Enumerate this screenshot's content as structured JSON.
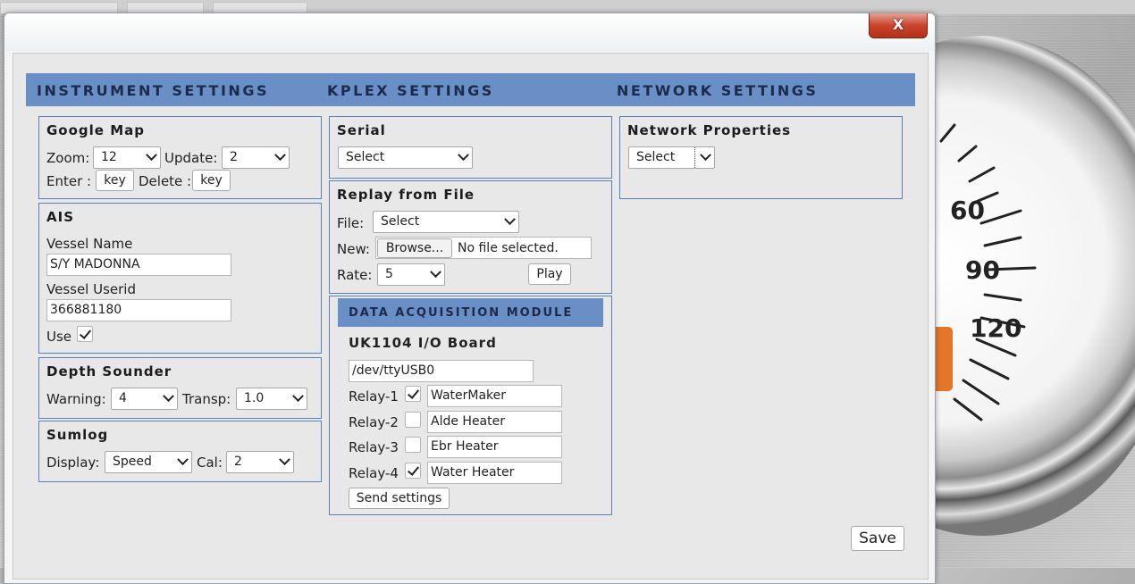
{
  "window": {
    "close_label": "X"
  },
  "headers": {
    "instrument": "INSTRUMENT SETTINGS",
    "kplex": "KPLEX SETTINGS",
    "network": "NETWORK SETTINGS"
  },
  "google_map": {
    "title": "Google Map",
    "zoom_label": "Zoom:",
    "zoom_value": "12",
    "update_label": "Update:",
    "update_value": "2",
    "enter_label": "Enter :",
    "enter_value": "key",
    "delete_label": "Delete :",
    "delete_value": "key"
  },
  "ais": {
    "title": "AIS",
    "vessel_name_label": "Vessel Name",
    "vessel_name_value": "S/Y MADONNA",
    "vessel_userid_label": "Vessel Userid",
    "vessel_userid_value": "366881180",
    "use_label": "Use",
    "use_checked": true
  },
  "depth": {
    "title": "Depth Sounder",
    "warning_label": "Warning:",
    "warning_value": "4",
    "transp_label": "Transp:",
    "transp_value": "1.0"
  },
  "sumlog": {
    "title": "Sumlog",
    "display_label": "Display:",
    "display_value": "Speed",
    "cal_label": "Cal:",
    "cal_value": "2"
  },
  "serial": {
    "title": "Serial",
    "select_value": "Select"
  },
  "replay": {
    "title": "Replay from File",
    "file_label": "File:",
    "file_value": "Select",
    "new_label": "New:",
    "browse_label": "Browse...",
    "no_file": "No file selected.",
    "rate_label": "Rate:",
    "rate_value": "5",
    "play_label": "Play"
  },
  "dam": {
    "title": "DATA ACQUISITION MODULE",
    "board_title": "UK1104 I/O Board",
    "device": "/dev/ttyUSB0",
    "relays": [
      {
        "label": "Relay-1",
        "checked": true,
        "name": "WaterMaker"
      },
      {
        "label": "Relay-2",
        "checked": false,
        "name": "Alde Heater"
      },
      {
        "label": "Relay-3",
        "checked": false,
        "name": "Ebr Heater"
      },
      {
        "label": "Relay-4",
        "checked": true,
        "name": "Water Heater"
      }
    ],
    "send_label": "Send settings"
  },
  "network": {
    "title": "Network Properties",
    "select_value": "Select"
  },
  "save_label": "Save",
  "gauge": {
    "ticks": [
      "60",
      "90",
      "120"
    ]
  }
}
